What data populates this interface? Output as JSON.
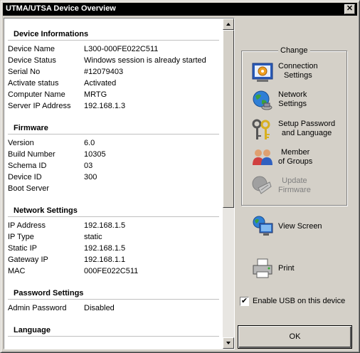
{
  "window": {
    "title": "UTMA/UTSA Device Overview",
    "close_label": "✕"
  },
  "sections": {
    "device": {
      "title": "Device Informations",
      "rows": [
        {
          "label": "Device Name",
          "value": "L300-000FE022C511"
        },
        {
          "label": "Device Status",
          "value": "Windows session is already started"
        },
        {
          "label": "Serial No",
          "value": "#12079403"
        },
        {
          "label": "Activate status",
          "value": "Activated"
        },
        {
          "label": "Computer Name",
          "value": "MRTG"
        },
        {
          "label": "Server IP Address",
          "value": "192.168.1.3"
        }
      ]
    },
    "firmware": {
      "title": "Firmware",
      "rows": [
        {
          "label": "Version",
          "value": "6.0"
        },
        {
          "label": "Build Number",
          "value": "10305"
        },
        {
          "label": "Schema ID",
          "value": "03"
        },
        {
          "label": "Device ID",
          "value": "300"
        },
        {
          "label": "Boot Server",
          "value": ""
        }
      ]
    },
    "network": {
      "title": "Network Settings",
      "rows": [
        {
          "label": "IP Address",
          "value": "192.168.1.5"
        },
        {
          "label": "IP Type",
          "value": "static"
        },
        {
          "label": "Static IP",
          "value": "192.168.1.5"
        },
        {
          "label": "Gateway IP",
          "value": "192.168.1.1"
        },
        {
          "label": "MAC",
          "value": "000FE022C511"
        }
      ]
    },
    "password": {
      "title": "Password Settings",
      "rows": [
        {
          "label": "Admin Password",
          "value": "Disabled"
        }
      ]
    },
    "language": {
      "title": "Language"
    }
  },
  "change": {
    "caption": "Change",
    "connection": {
      "line1": "Connection",
      "line2": "Settings"
    },
    "network": {
      "line1": "Network",
      "line2": "Settings"
    },
    "password": {
      "line1": "Setup Password",
      "line2": "and Language"
    },
    "groups": {
      "line1": "Member",
      "line2": "of Groups"
    },
    "firmware": {
      "line1": "Update",
      "line2": "Firmware"
    }
  },
  "view_screen_label": "View Screen",
  "print_label": "Print",
  "usb": {
    "label": "Enable USB on this device",
    "checked": true,
    "check_mark": "✔"
  },
  "ok_label": "OK",
  "icons": {
    "connection": "connection-settings-icon",
    "network": "globe-network-icon",
    "password": "keys-icon",
    "groups": "users-group-icon",
    "firmware": "chip-icon",
    "view": "monitor-globe-icon",
    "print": "printer-icon"
  }
}
